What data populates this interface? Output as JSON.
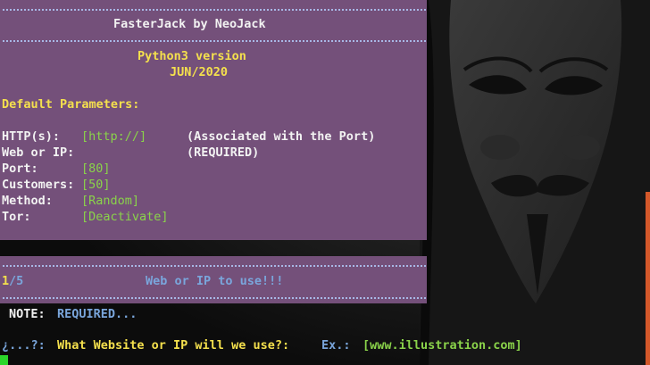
{
  "banner": {
    "title": "FasterJack by NeoJack",
    "version": "Python3 version",
    "date": "JUN/2020"
  },
  "defaults": {
    "heading": "Default Parameters:",
    "http_label": "HTTP(s):",
    "http_value": "[http://]",
    "http_note": "(Associated with the Port)",
    "web_label": "Web or IP:",
    "web_note": "(REQUIRED)",
    "port_label": "Port:",
    "port_value": "[80]",
    "customers_label": "Customers:",
    "customers_value": "[50]",
    "method_label": "Method:",
    "method_value": "[Random]",
    "tor_label": "Tor:",
    "tor_value": "[Deactivate]"
  },
  "step": {
    "current": "1",
    "total": "/5",
    "title": "Web or IP to use!!!"
  },
  "note": {
    "label": "NOTE:",
    "value": "REQUIRED..."
  },
  "prompt": {
    "marker": "¿...?:",
    "question": "What Website or IP will we use?:",
    "example_label": "Ex.:",
    "example_value": "[www.illustration.com]"
  },
  "colors": {
    "panel": "#74507a",
    "dots": "#a8b8e6",
    "text": "#f2f2f2",
    "yellow": "#f4e04d",
    "green": "#8ad34a",
    "blue": "#7aa6dc",
    "cursor": "#2bd62b",
    "background": "#1a1a1a"
  },
  "wallpaper": {
    "icon": "guy-fawkes-mask-icon"
  }
}
